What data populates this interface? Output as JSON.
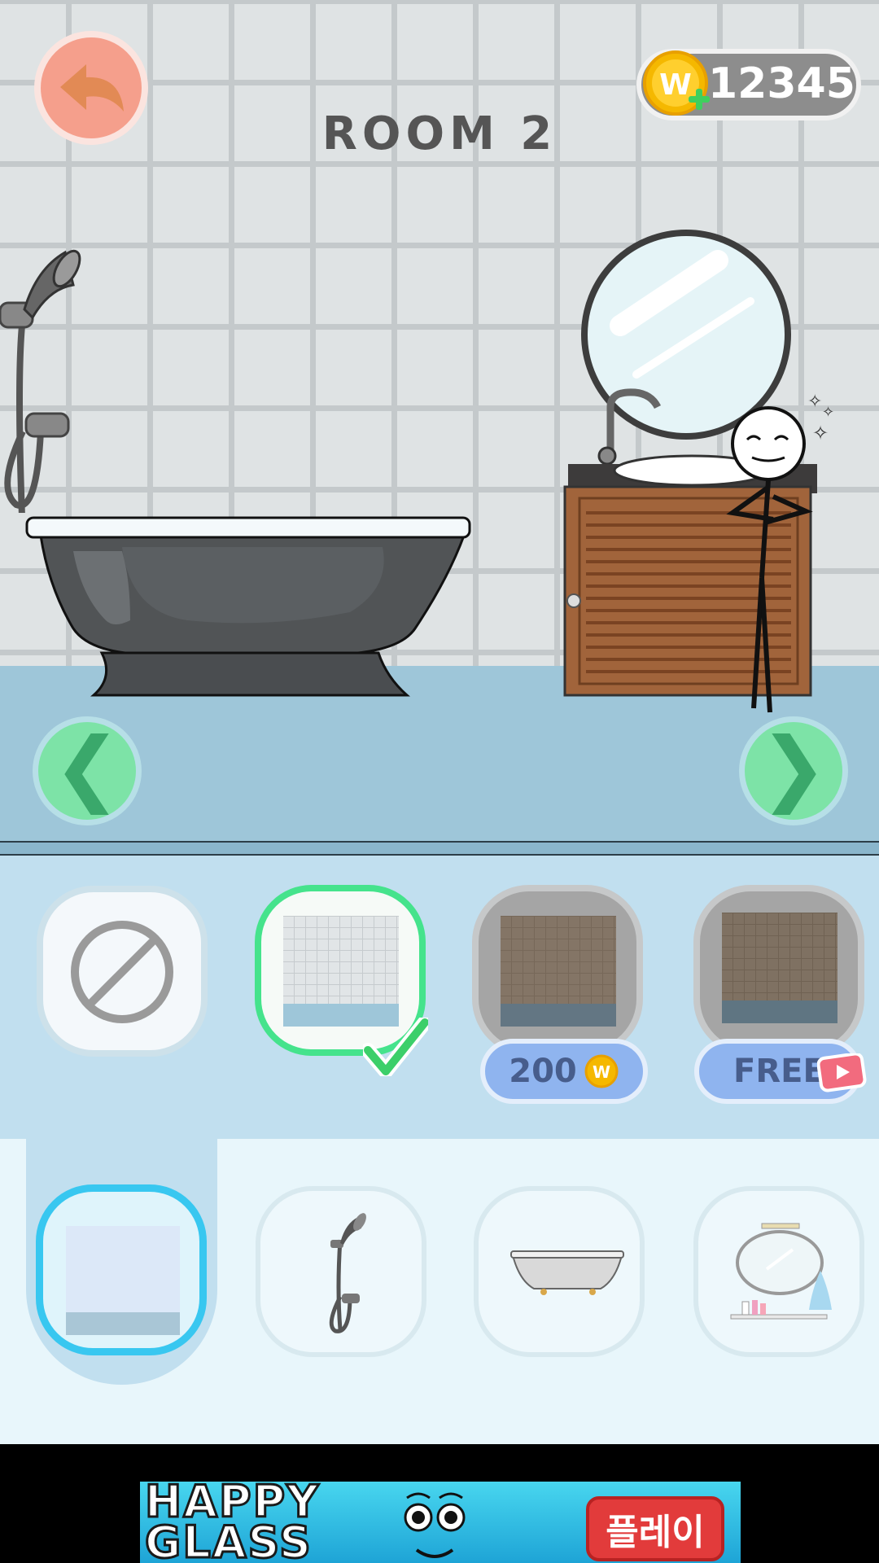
{
  "header": {
    "title": "ROOM 2",
    "coins": "12345"
  },
  "options": [
    {
      "name": "none",
      "state": "available"
    },
    {
      "name": "light-tiles",
      "state": "selected"
    },
    {
      "name": "brown-tiles",
      "state": "locked",
      "price": "200"
    },
    {
      "name": "dark-tiles",
      "state": "locked",
      "price": "FREE"
    }
  ],
  "categories": [
    {
      "name": "wall",
      "active": true
    },
    {
      "name": "shower",
      "active": false
    },
    {
      "name": "bathtub",
      "active": false
    },
    {
      "name": "vanity",
      "active": false
    }
  ],
  "ad": {
    "title_line1": "HAPPY",
    "title_line2": "GLASS",
    "button_label": "플레이"
  },
  "colors": {
    "accent_green": "#45e38c",
    "accent_blue": "#38c7f0",
    "back_button": "#f59f8c",
    "coin_gold": "#f5b800"
  },
  "icons": [
    "back-arrow-icon",
    "coin-icon",
    "plus-icon",
    "chevron-left-icon",
    "chevron-right-icon",
    "none-icon",
    "checkmark-icon",
    "video-play-icon"
  ]
}
